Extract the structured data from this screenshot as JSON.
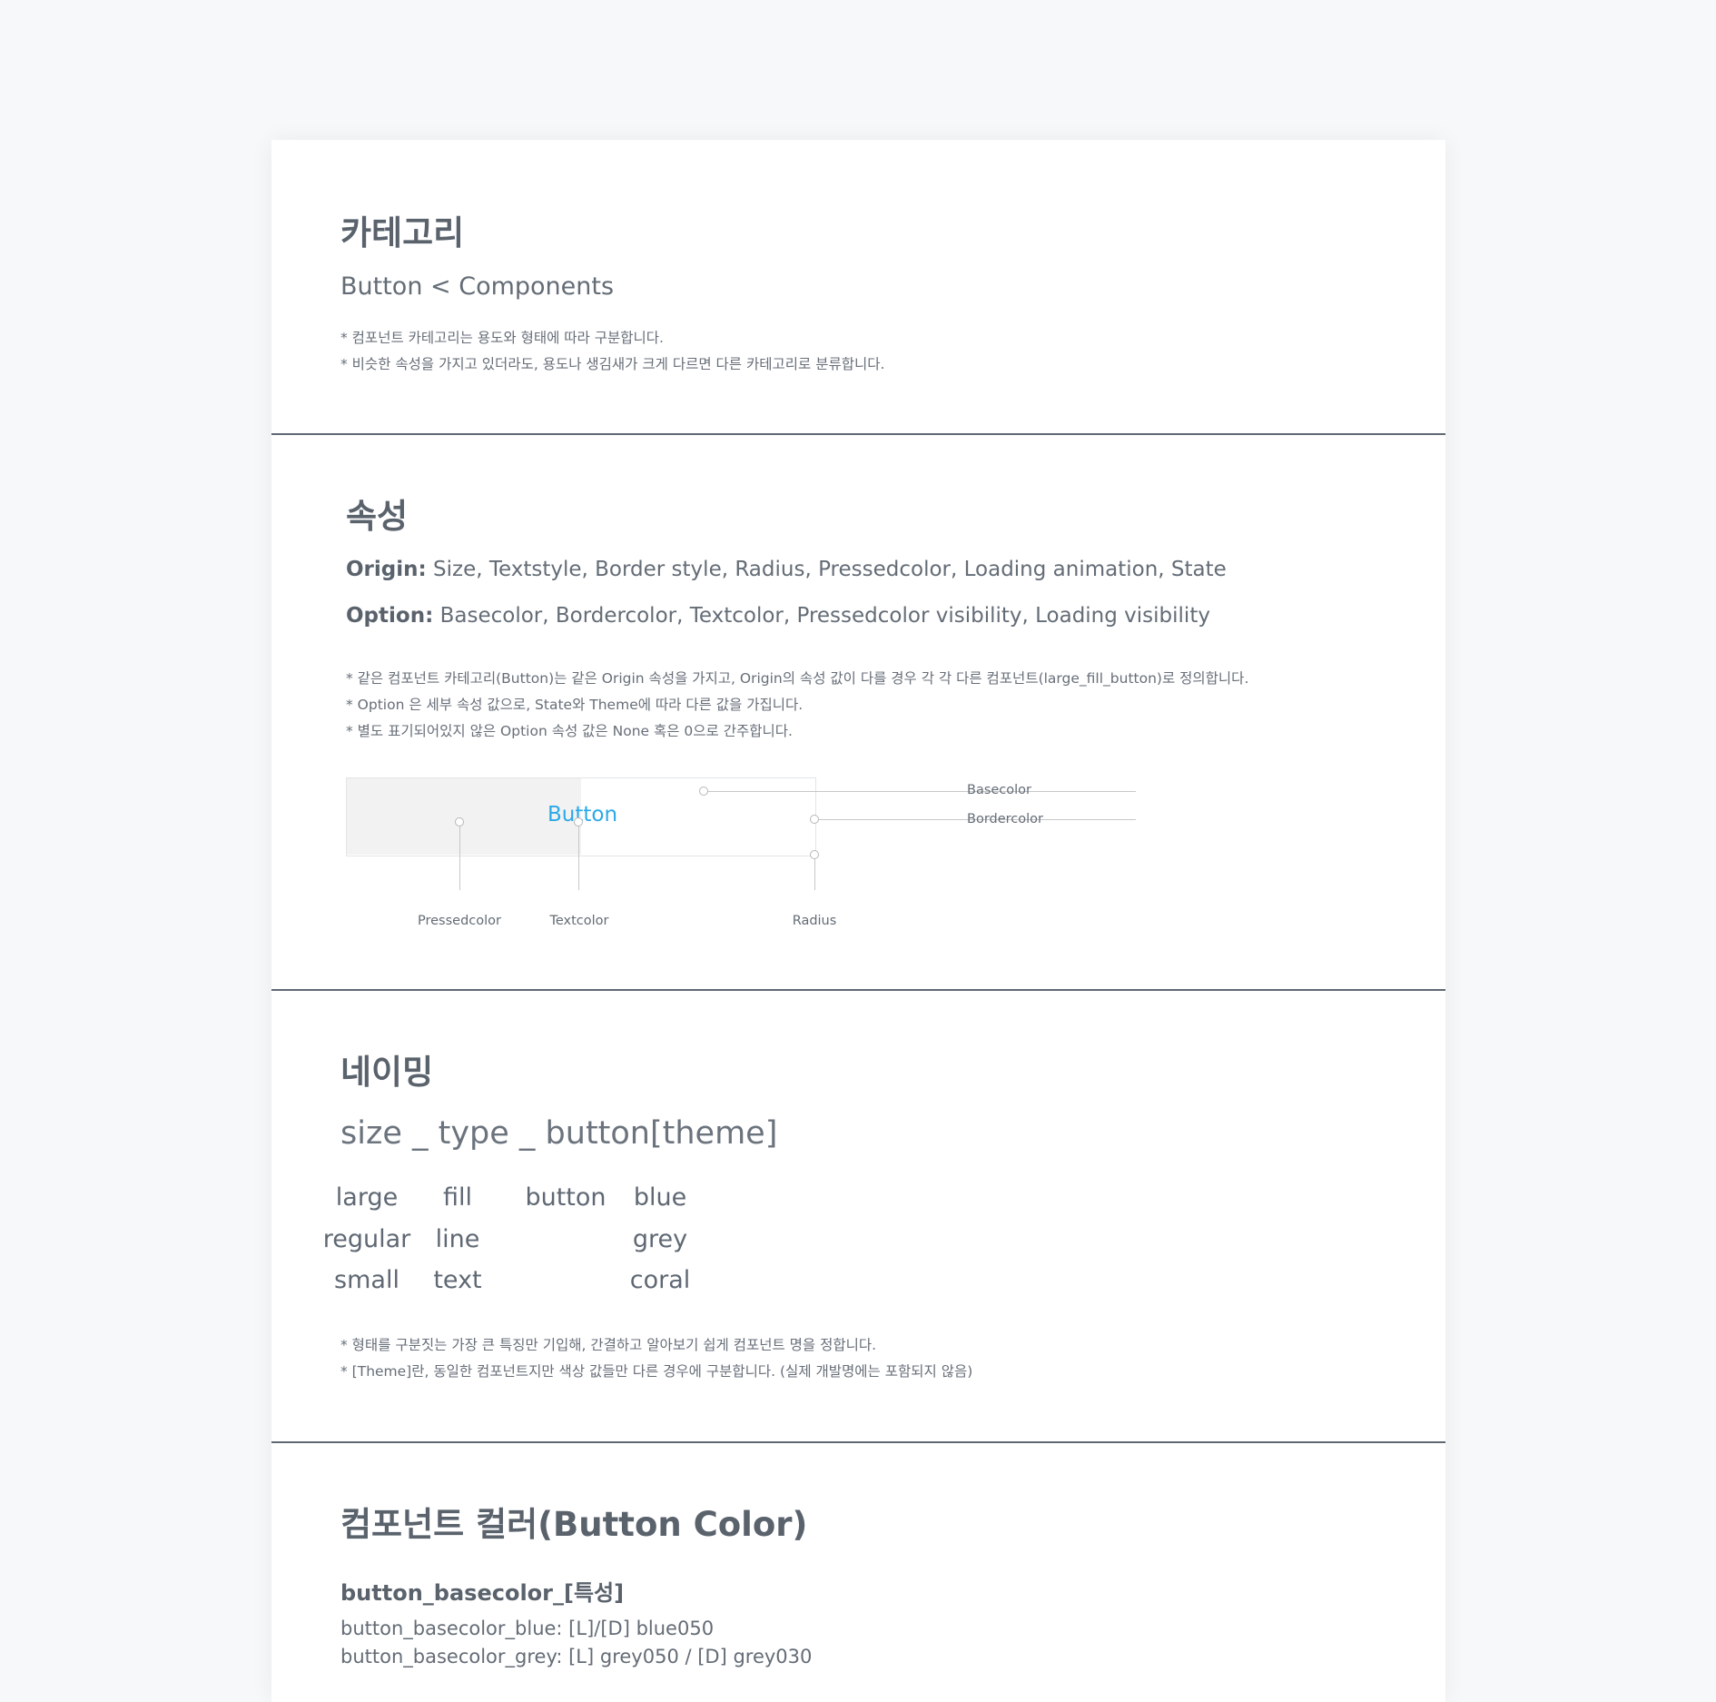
{
  "category": {
    "title": "카테고리",
    "breadcrumb": "Button < Components",
    "notes": [
      "* 컴포넌트 카테고리는 용도와 형태에 따라 구분합니다.",
      "* 비슷한 속성을 가지고 있더라도, 용도나 생김새가 크게 다르면 다른 카테고리로 분류합니다."
    ]
  },
  "attributes": {
    "title": "속성",
    "origin_label": "Origin:",
    "origin_value": " Size, Textstyle, Border style, Radius, Pressedcolor, Loading animation, State",
    "option_label": "Option:",
    "option_value": " Basecolor, Bordercolor, Textcolor, Pressedcolor visibility, Loading visibility",
    "notes": [
      "* 같은 컴포넌트 카테고리(Button)는 같은 Origin 속성을 가지고, Origin의 속성 값이 다를 경우 각 각 다른 컴포넌트(large_fill_button)로 정의합니다.",
      "* Option 은 세부 속성 값으로, State와 Theme에 따라 다른 값을 가집니다.",
      "* 별도 표기되어있지 않은 Option 속성 값은 None 혹은 0으로 간주합니다."
    ],
    "diagram": {
      "button_label": "Button",
      "labels": {
        "basecolor": "Basecolor",
        "bordercolor": "Bordercolor",
        "pressedcolor": "Pressedcolor",
        "textcolor": "Textcolor",
        "radius": "Radius"
      },
      "button_text_color": "#2aa9e8",
      "pressed_fill_color": "#f2f2f2"
    }
  },
  "naming": {
    "title": "네이밍",
    "pattern": "size _ type _ button[theme]",
    "columns": [
      [
        "large",
        "regular",
        "small"
      ],
      [
        "fill",
        "line",
        "text"
      ],
      [
        "button"
      ],
      [
        "blue",
        "grey",
        "coral"
      ]
    ],
    "notes": [
      "* 형태를 구분짓는 가장 큰 특징만 기입해, 간결하고 알아보기 쉽게 컴포넌트 명을 정합니다.",
      "* [Theme]란, 동일한 컴포넌트지만 색상 값들만 다른 경우에 구분합니다. (실제 개발명에는 포함되지 않음)"
    ]
  },
  "color": {
    "title": "컴포넌트 컬러(Button Color)",
    "subtitle": "button_basecolor_[특성]",
    "lines": [
      "button_basecolor_blue: [L]/[D] blue050",
      "button_basecolor_grey: [L] grey050 / [D] grey030"
    ]
  }
}
